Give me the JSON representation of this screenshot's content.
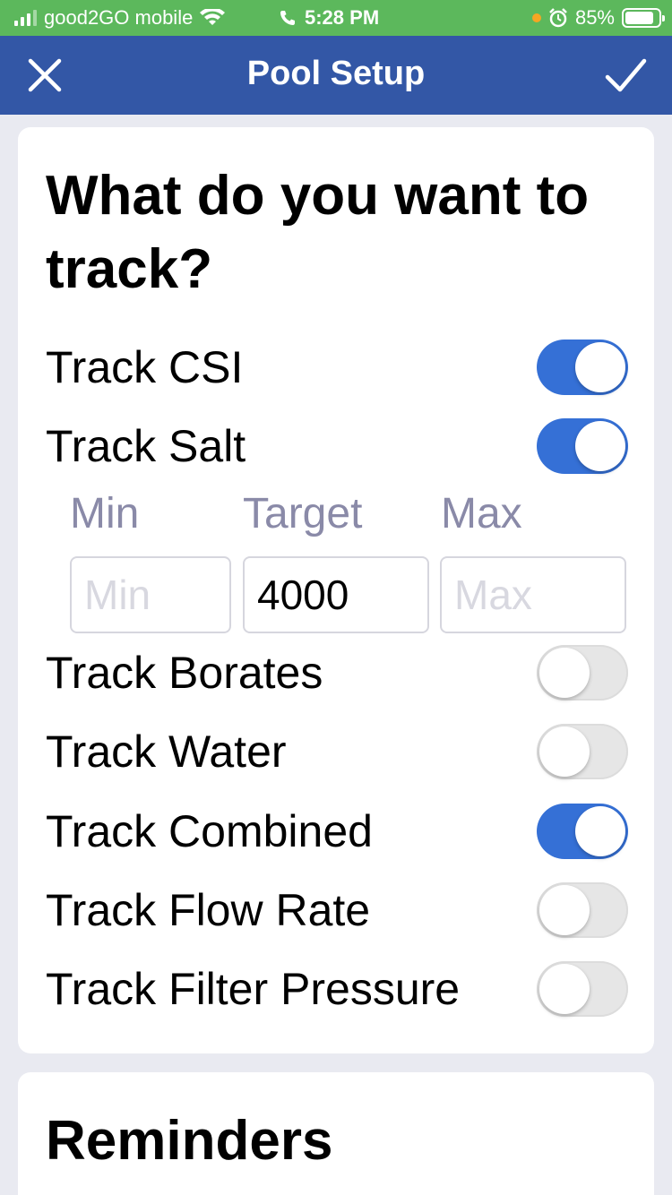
{
  "status_bar": {
    "carrier": "good2GO mobile",
    "time": "5:28 PM",
    "battery": "85%",
    "icons": [
      "signal-icon",
      "wifi-icon",
      "phone-icon",
      "alarm-icon",
      "battery-icon"
    ]
  },
  "nav": {
    "title": "Pool Setup",
    "close_icon": "close-icon",
    "confirm_icon": "checkmark-icon",
    "color": "#3357a6"
  },
  "track_card": {
    "heading": "What do you want to track?",
    "items": [
      {
        "label": "Track CSI",
        "on": true
      },
      {
        "label": "Track Salt",
        "on": true
      },
      {
        "label": "Track Borates",
        "on": false
      },
      {
        "label": "Track Water",
        "on": false
      },
      {
        "label": "Track Combined",
        "on": true
      },
      {
        "label": "Track Flow Rate",
        "on": false
      },
      {
        "label": "Track Filter Pressure",
        "on": false
      }
    ],
    "salt_range": {
      "min_label": "Min",
      "target_label": "Target",
      "max_label": "Max",
      "min_placeholder": "Min",
      "target_value": "4000",
      "max_placeholder": "Max"
    },
    "toggle_on_color": "#3570d6"
  },
  "reminders_card": {
    "heading": "Reminders"
  }
}
